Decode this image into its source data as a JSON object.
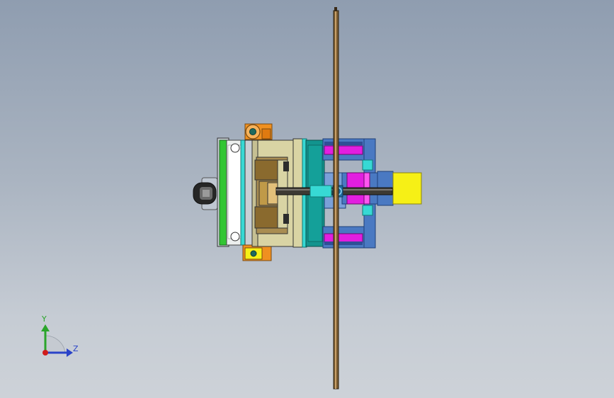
{
  "scene": {
    "background_top": "#8f9db0",
    "background_bottom": "#cdd2d8"
  },
  "triad": {
    "y_label": "Y",
    "z_label": "Z",
    "y_color": "#2aa52a",
    "z_color": "#2a43c8",
    "origin_color": "#d01c1c"
  },
  "model": {
    "icon": "mold-assembly-icon",
    "colors": {
      "shaft": "#7a5c32",
      "green_plate": "#33c633",
      "cyan": "#37d9d4",
      "teal": "#12948e",
      "beige": "#d9d4a4",
      "brown": "#8a6a2e",
      "blue": "#4a79c2",
      "magenta": "#e21ee0",
      "yellow": "#f6f016",
      "orange": "#f09020"
    }
  }
}
